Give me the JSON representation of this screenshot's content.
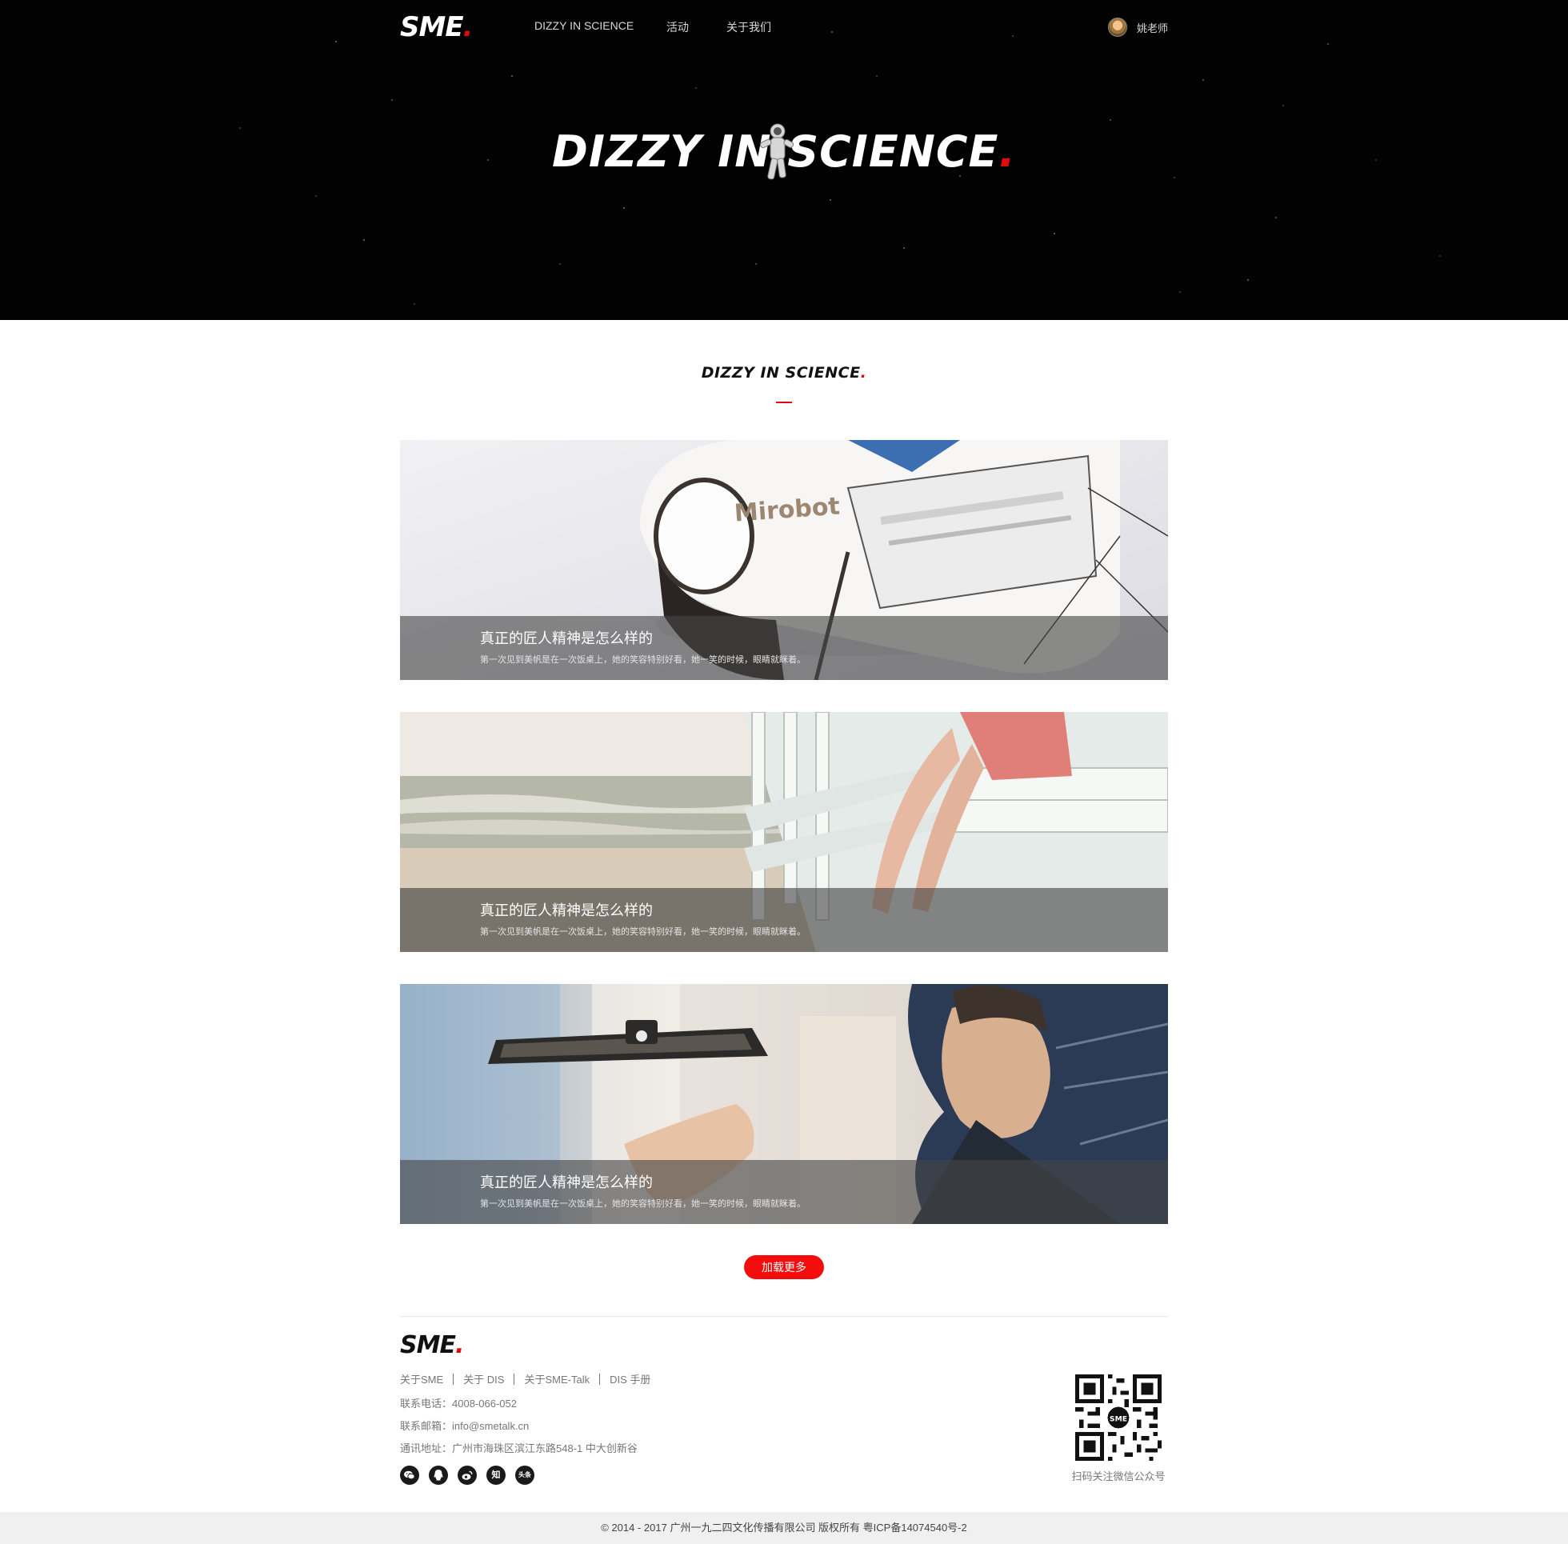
{
  "nav": {
    "logo_text": "SME",
    "logo_dot": ".",
    "items": [
      {
        "label": "DIZZY IN SCIENCE"
      },
      {
        "label": "活动"
      },
      {
        "label": "关于我们"
      }
    ],
    "user_name": "姚老师"
  },
  "hero": {
    "title": "DIZZY IN SCIENCE",
    "dot": "."
  },
  "section": {
    "title": "DIZZY IN SCIENCE",
    "dot": "."
  },
  "articles": [
    {
      "title": "真正的匠人精神是怎么样的",
      "desc": "第一次见到美帆是在一次饭桌上，她的笑容特别好看，她一笑的时候，眼睛就眯着。",
      "image": "Mirobot robot photo"
    },
    {
      "title": "真正的匠人精神是怎么样的",
      "desc": "第一次见到美帆是在一次饭桌上，她的笑容特别好看，她一笑的时候，眼睛就眯着。",
      "image": "lifeguard tower beach photo"
    },
    {
      "title": "真正的匠人精神是怎么样的",
      "desc": "第一次见到美帆是在一次饭桌上，她的笑容特别好看，她一笑的时候，眼睛就眯着。",
      "image": "hover camera drone photo"
    }
  ],
  "load_more_label": "加载更多",
  "footer": {
    "logo_text": "SME",
    "logo_dot": ".",
    "links": [
      "关于SME",
      "关于 DIS",
      "关于SME-Talk",
      "DIS 手册"
    ],
    "phone": "联系电话：4008-066-052",
    "email": "联系邮箱：info@smetalk.cn",
    "address": "通讯地址：广州市海珠区滨江东路548-1 中大创新谷",
    "social": [
      {
        "icon": "wechat-icon"
      },
      {
        "icon": "qq-icon"
      },
      {
        "icon": "weibo-icon"
      },
      {
        "icon": "zhihu-icon",
        "text": "知"
      },
      {
        "icon": "toutiao-icon",
        "text": "头条"
      }
    ],
    "qr_center": "SME",
    "qr_label": "扫码关注微信公众号",
    "copyright": "© 2014 - 2017 广州一九二四文化传播有限公司   版权所有   粤ICP备14074540号-2"
  },
  "colors": {
    "accent": "#e00a0a",
    "hero_bg": "#020202",
    "button": "#f20c0c",
    "copyright_bg": "#f0f0f0"
  }
}
